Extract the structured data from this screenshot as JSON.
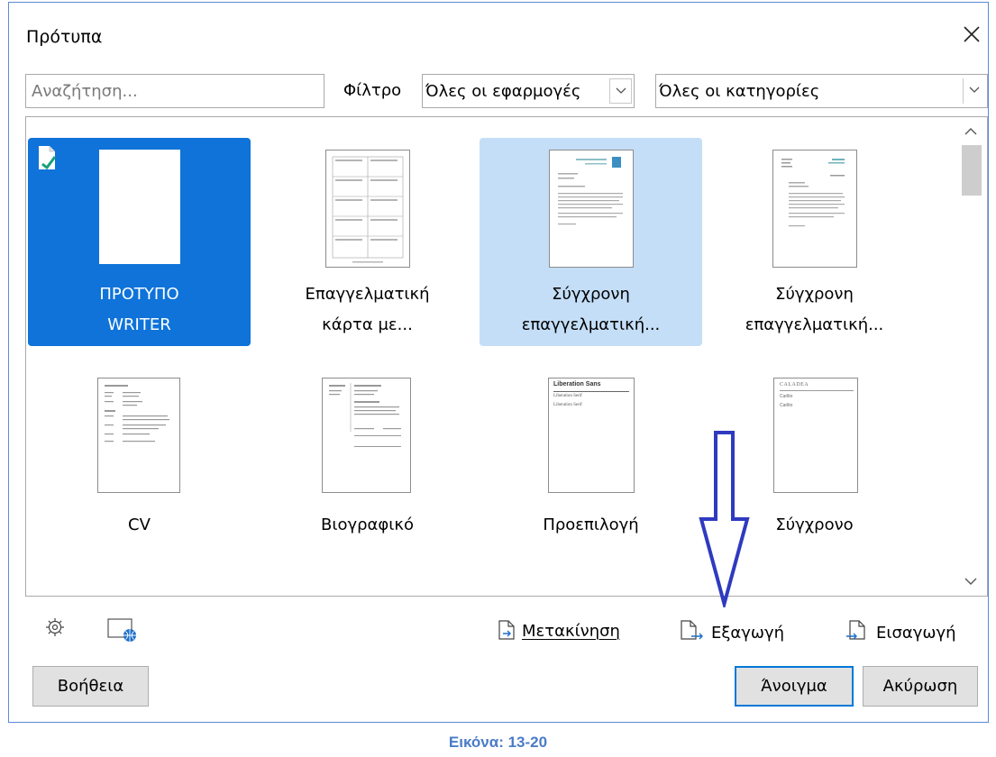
{
  "dialog": {
    "title": "Πρότυπα",
    "search_placeholder": "Αναζήτηση...",
    "filter_label": "Φίλτρο",
    "apps_select": "Όλες οι εφαρμογές",
    "categories_select": "Όλες οι κατηγορίες"
  },
  "templates": [
    {
      "line1": "ΠΡΟΤΥΠΟ",
      "line2": "WRITER",
      "state": "selected"
    },
    {
      "line1": "Επαγγελματική",
      "line2": "κάρτα με...",
      "state": "normal"
    },
    {
      "line1": "Σύγχρονη",
      "line2": "επαγγελματική...",
      "state": "hover"
    },
    {
      "line1": "Σύγχρονη",
      "line2": "επαγγελματική...",
      "state": "normal"
    },
    {
      "line1": "CV",
      "state": "normal"
    },
    {
      "line1": "Βιογραφικό",
      "state": "normal"
    },
    {
      "line1": "Προεπιλογή",
      "state": "normal"
    },
    {
      "line1": "Σύγχρονο",
      "state": "normal"
    }
  ],
  "thumb_text": {
    "liberation_title": "Liberation Sans",
    "liberation_sub1": "Liberation Serif",
    "liberation_sub2": "Liberation Serif",
    "caladea_title": "CALADEA",
    "caladea_sub1": "Carlito",
    "caladea_sub2": "Carlito"
  },
  "actions": {
    "move": "Μετακίνηση",
    "export": "Εξαγωγή",
    "import": "Εισαγωγή"
  },
  "buttons": {
    "help": "Βοήθεια",
    "open": "Άνοιγμα",
    "cancel": "Ακύρωση"
  },
  "caption": "Εικόνα: 13-20",
  "colors": {
    "selected": "#0f73d9",
    "hover": "#c4def7",
    "annotation_arrow": "#2f3ac0",
    "caption": "#4a7cc7"
  },
  "icons": [
    "close-icon",
    "chevron-down-icon",
    "chevron-up-icon",
    "settings-icon",
    "online-templates-icon",
    "move-icon",
    "export-icon",
    "import-icon",
    "check-icon",
    "arrow-down-annotation"
  ]
}
